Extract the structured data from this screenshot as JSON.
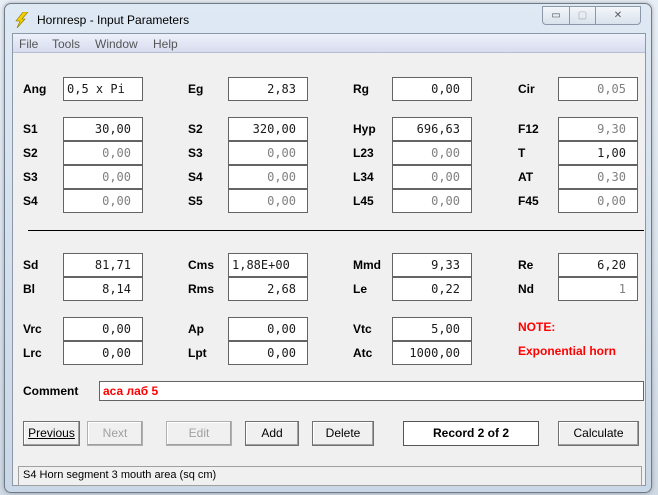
{
  "window": {
    "title": "Hornresp - Input Parameters",
    "minimize": "▭",
    "maximize": "▢",
    "close": "✕"
  },
  "menu": [
    "File",
    "Tools",
    "Window",
    "Help"
  ],
  "fields_top": [
    {
      "label": "Ang",
      "value": "0,5 x Pi"
    },
    {
      "label": "Eg",
      "value": "2,83"
    },
    {
      "label": "Rg",
      "value": "0,00"
    },
    {
      "label": "Cir",
      "value": "0,05"
    }
  ],
  "horn_grid": [
    [
      {
        "label": "S1",
        "value": "30,00"
      },
      {
        "label": "S2",
        "value": "320,00"
      },
      {
        "label": "Hyp",
        "value": "696,63"
      },
      {
        "label": "F12",
        "value": "9,30"
      }
    ],
    [
      {
        "label": "S2",
        "value": "0,00"
      },
      {
        "label": "S3",
        "value": "0,00"
      },
      {
        "label": "L23",
        "value": "0,00"
      },
      {
        "label": "T",
        "value": "1,00"
      }
    ],
    [
      {
        "label": "S3",
        "value": "0,00"
      },
      {
        "label": "S4",
        "value": "0,00"
      },
      {
        "label": "L34",
        "value": "0,00"
      },
      {
        "label": "AT",
        "value": "0,30"
      }
    ],
    [
      {
        "label": "S4",
        "value": "0,00"
      },
      {
        "label": "S5",
        "value": "0,00"
      },
      {
        "label": "L45",
        "value": "0,00"
      },
      {
        "label": "F45",
        "value": "0,00"
      }
    ]
  ],
  "driver": [
    [
      {
        "label": "Sd",
        "value": "81,71"
      },
      {
        "label": "Cms",
        "value": "1,88E+00"
      },
      {
        "label": "Mmd",
        "value": "9,33"
      },
      {
        "label": "Re",
        "value": "6,20"
      }
    ],
    [
      {
        "label": "Bl",
        "value": "8,14"
      },
      {
        "label": "Rms",
        "value": "2,68"
      },
      {
        "label": "Le",
        "value": "0,22"
      },
      {
        "label": "Nd",
        "value": "1"
      }
    ]
  ],
  "chambers": [
    [
      {
        "label": "Vrc",
        "value": "0,00"
      },
      {
        "label": "Ap",
        "value": "0,00"
      },
      {
        "label": "Vtc",
        "value": "5,00"
      }
    ],
    [
      {
        "label": "Lrc",
        "value": "0,00"
      },
      {
        "label": "Lpt",
        "value": "0,00"
      },
      {
        "label": "Atc",
        "value": "1000,00"
      }
    ]
  ],
  "note": {
    "title": "NOTE:",
    "text": "Exponential horn"
  },
  "comment": {
    "label": "Comment",
    "value": "аса лаб 5"
  },
  "buttons": {
    "previous": "Previous",
    "next": "Next",
    "edit": "Edit",
    "add": "Add",
    "delete": "Delete",
    "calculate": "Calculate"
  },
  "record": "Record 2 of 2",
  "status": "S4   Horn segment 3 mouth area  (sq cm)"
}
